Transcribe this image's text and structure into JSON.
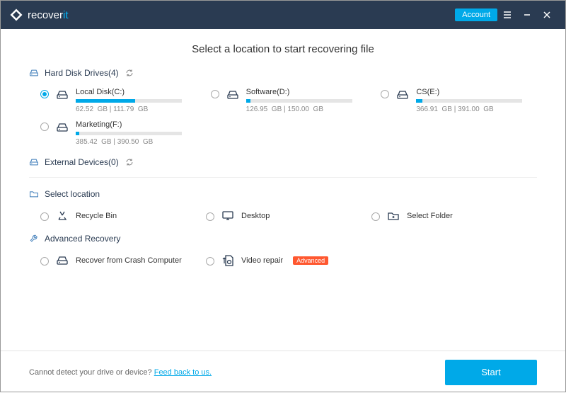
{
  "header": {
    "brand_prefix": "recover",
    "brand_suffix": "it",
    "account_label": "Account"
  },
  "main": {
    "title": "Select a location to start recovering file"
  },
  "sections": {
    "hdd": {
      "label": "Hard Disk Drives(4)"
    },
    "ext": {
      "label": "External Devices(0)"
    },
    "sel": {
      "label": "Select location"
    },
    "adv": {
      "label": "Advanced Recovery"
    }
  },
  "drives": [
    {
      "name": "Local Disk(C:)",
      "used": "62.52",
      "total": "111.79",
      "unit": "GB",
      "pct": 56,
      "selected": true
    },
    {
      "name": "Software(D:)",
      "used": "126.95",
      "total": "150.00",
      "unit": "GB",
      "pct": 4,
      "selected": false
    },
    {
      "name": "CS(E:)",
      "used": "366.91",
      "total": "391.00",
      "unit": "GB",
      "pct": 6,
      "selected": false
    },
    {
      "name": "Marketing(F:)",
      "used": "385.42",
      "total": "390.50",
      "unit": "GB",
      "pct": 3,
      "selected": false
    }
  ],
  "locations": [
    {
      "key": "recycle",
      "label": "Recycle Bin"
    },
    {
      "key": "desktop",
      "label": "Desktop"
    },
    {
      "key": "folder",
      "label": "Select Folder"
    }
  ],
  "advanced": [
    {
      "key": "crash",
      "label": "Recover from Crash Computer",
      "badge": null
    },
    {
      "key": "video",
      "label": "Video repair",
      "badge": "Advanced"
    }
  ],
  "footer": {
    "text": "Cannot detect your drive or device? ",
    "link": "Feed back to us.",
    "start": "Start"
  }
}
